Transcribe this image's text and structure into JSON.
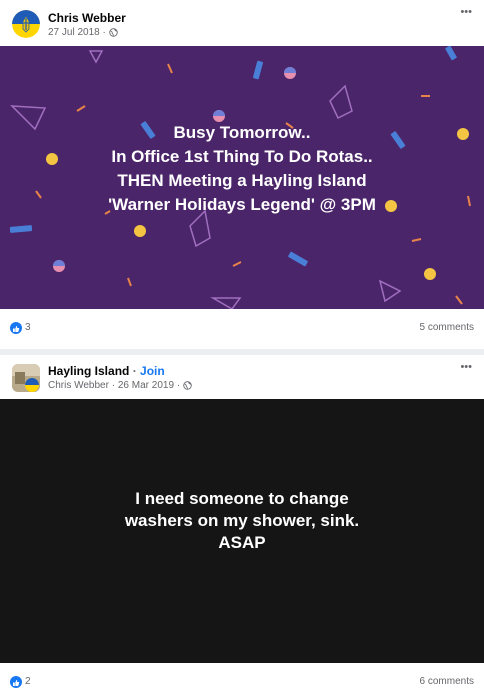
{
  "posts": [
    {
      "author": "Chris Webber",
      "date": "27 Jul 2018",
      "meta_separator": "·",
      "more_icon": "more-icon",
      "background_color": "#4b2569",
      "text_lines": [
        "Busy Tomorrow..",
        "In Office 1st Thing To Do Rotas..",
        "THEN Meeting a Hayling Island",
        "'Warner Holidays Legend' @ 3PM"
      ],
      "like_count": "3",
      "comment_count": "5 comments"
    },
    {
      "group": "Hayling Island",
      "join_separator": "·",
      "join_label": "Join",
      "author": "Chris Webber",
      "date": "26 Mar 2019",
      "meta_separator": "·",
      "more_icon": "more-icon",
      "background_color": "#151515",
      "text_lines": [
        "I need someone to change",
        "washers on my shower, sink.",
        "ASAP"
      ],
      "like_count": "2",
      "comment_count": "6 comments"
    }
  ],
  "icons": {
    "like": "like-icon",
    "privacy": "globe-icon",
    "more": "more-icon"
  },
  "colors": {
    "accent": "#1877f2",
    "text_secondary": "#65676b"
  }
}
